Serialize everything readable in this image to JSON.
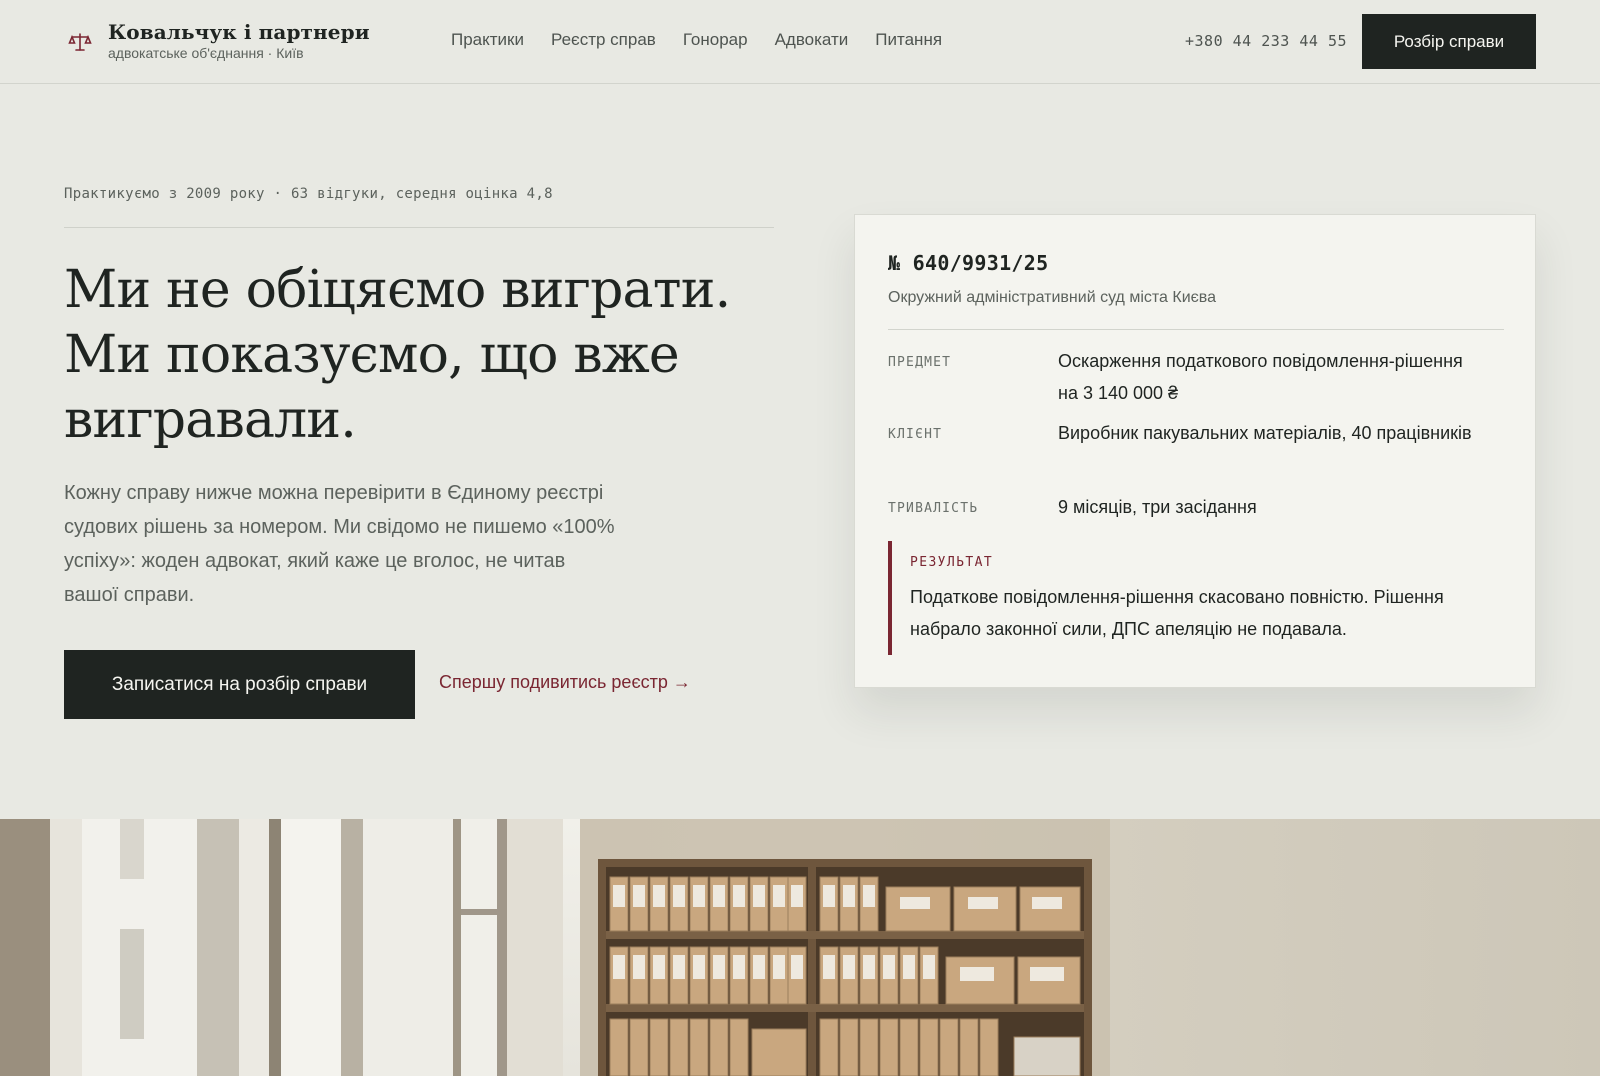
{
  "header": {
    "brand_name": "Ковальчук і партнери",
    "brand_sub": "адвокатське об'єднання · Київ",
    "brand_icon": "scales-icon",
    "nav": [
      "Практики",
      "Реєстр справ",
      "Гонорар",
      "Адвокати",
      "Питання"
    ],
    "phone": "+380 44 233 44 55",
    "cta_label": "Розбір справи"
  },
  "hero": {
    "eyebrow": "Практикуємо з 2009 року · 63 відгуки, середня оцінка 4,8",
    "headline": "Ми не обіцяємо виграти. Ми показуємо, що вже вигравали.",
    "lead": "Кожну справу нижче можна перевірити в Єдиному реєстрі судових рішень за номером. Ми свідомо не пишемо «100% успіху»: жоден адвокат, який каже це вголос, не читав вашої справи.",
    "cta_label": "Записатися на розбір справи",
    "link_label": "Спершу подивитись реєстр →"
  },
  "case": {
    "number": "№ 640/9931/25",
    "court": "Окружний адміністративний суд міста Києва",
    "rows": [
      {
        "label": "ПРЕДМЕТ",
        "value": "Оскарження податкового повідомлення-рішення на 3 140 000 ₴"
      },
      {
        "label": "КЛІЄНТ",
        "value": "Виробник пакувальних матеріалів, 40 працівників"
      },
      {
        "label": "ТРИВАЛІСТЬ",
        "value": "9 місяців, три засідання"
      }
    ],
    "result_label": "РЕЗУЛЬТАТ",
    "result_text": "Податкове повідомлення-рішення скасовано повністю. Рішення набрало законної сили, ДПС апеляцію не подавала."
  },
  "colors": {
    "background": "#e8e9e3",
    "ink": "#1f2421",
    "accent": "#7a2632",
    "card": "#f4f4ef"
  }
}
